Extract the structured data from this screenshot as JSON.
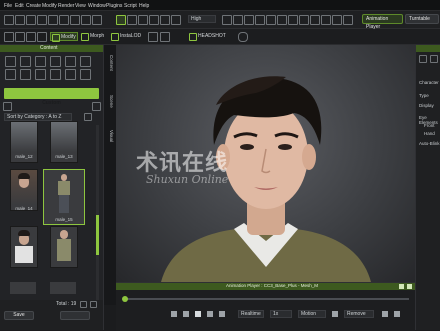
{
  "menubar": {
    "items": [
      "File",
      "Edit",
      "Create",
      "Modify",
      "Render",
      "View",
      "Window",
      "Plugins",
      "Script",
      "Help"
    ]
  },
  "toolbar1": {
    "quality_value": "High",
    "animation_player_label": "Animation Player",
    "turntable_label": "Turntable"
  },
  "toolbar2": {
    "modify_label": "Modify",
    "morph_label": "Morph",
    "inslod_label": "InstaLOD",
    "headshot_label": "HEADSHOT"
  },
  "content": {
    "title": "Content",
    "tab_button_label": "Custom",
    "sort_label": "Sort by Category : A to Z",
    "items": [
      {
        "name": "male_12"
      },
      {
        "name": "male_13"
      },
      {
        "name": "male_14"
      },
      {
        "name": "male_15"
      },
      {
        "name": "male_6"
      },
      {
        "name": "male_hair_test"
      }
    ],
    "footer": {
      "save": "Save",
      "total": "Total : 19"
    }
  },
  "side_tabs": [
    "Content",
    "Scene",
    "Visual"
  ],
  "watermark": {
    "cn": "术讯在线",
    "en": "Shuxun Online"
  },
  "animation_player": {
    "title": "Animation Player : CC3_Base_Plus - Mesh_M",
    "realtime_label": "Realtime",
    "speed_value": "1x",
    "motion_label": "Motion",
    "remove_label": "Remove"
  },
  "right_panel": {
    "labels": [
      "Character",
      "Type",
      "Display",
      "Eye Elements",
      "Front",
      "Hand",
      "Auto-Blink"
    ]
  },
  "colors": {
    "accent": "#8ec63f",
    "header": "#3d5a1f"
  }
}
